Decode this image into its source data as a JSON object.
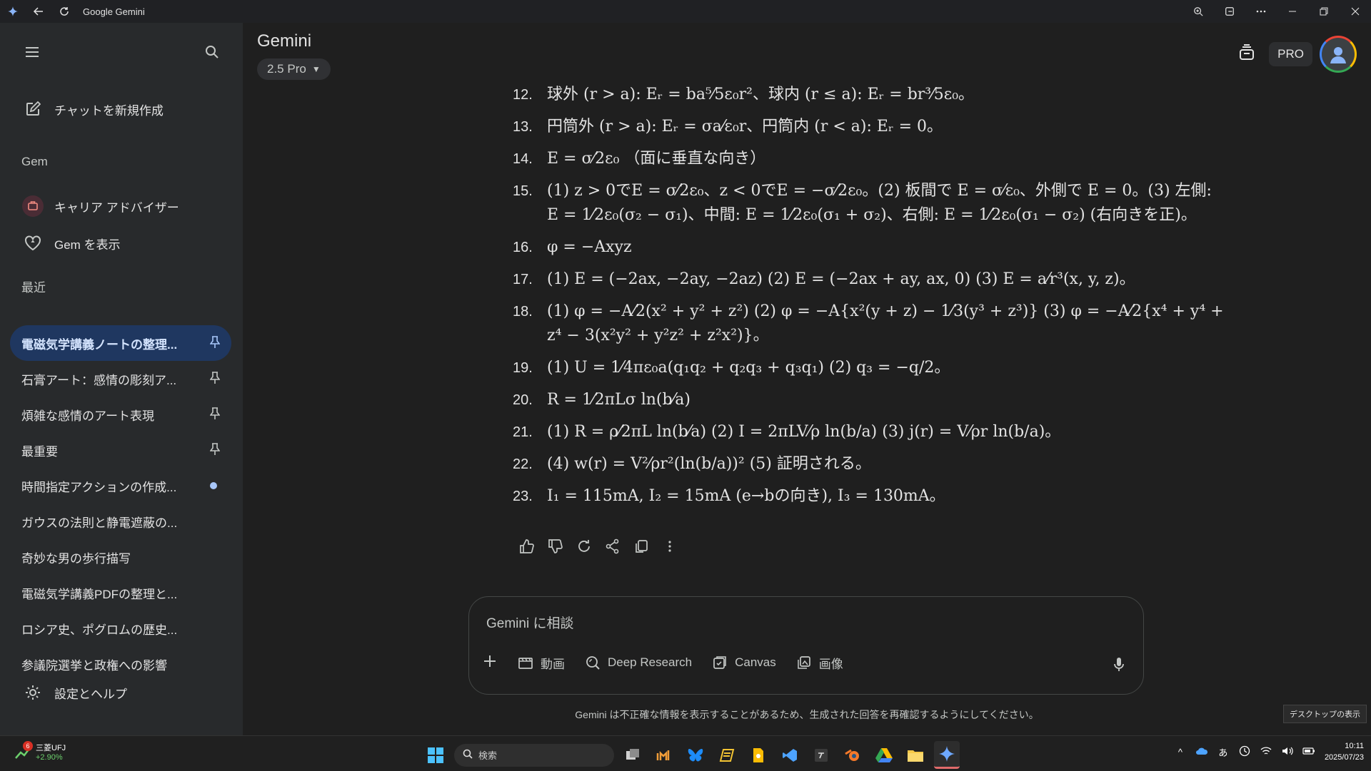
{
  "window": {
    "title": "Google Gemini"
  },
  "sidebar": {
    "new_chat": "チャットを新規作成",
    "gem_section": "Gem",
    "gems": [
      {
        "label": "キャリア アドバイザー"
      },
      {
        "label": "Gem を表示"
      }
    ],
    "recent_section": "最近",
    "recent": [
      {
        "label": "電磁気学講義ノートの整理...",
        "active": true,
        "marker": "pin"
      },
      {
        "label": "石膏アート：感情の彫刻ア...",
        "marker": "pin"
      },
      {
        "label": "煩雑な感情のアート表現",
        "marker": "pin"
      },
      {
        "label": "最重要",
        "marker": "pin"
      },
      {
        "label": "時間指定アクションの作成...",
        "marker": "dot"
      },
      {
        "label": "ガウスの法則と静電遮蔽の..."
      },
      {
        "label": "奇妙な男の歩行描写"
      },
      {
        "label": "電磁気学講義PDFの整理と..."
      },
      {
        "label": "ロシア史、ポグロムの歴史..."
      },
      {
        "label": "参議院選挙と政権への影響"
      }
    ],
    "settings": "設定とヘルプ"
  },
  "header": {
    "app_name": "Gemini",
    "model": "2.5 Pro",
    "badge": "PRO"
  },
  "answers": [
    {
      "num": "12.",
      "text": "球外 (r > a): Eᵣ = ba⁵⁄5ε₀r²、球内 (r ≤ a): Eᵣ = br³⁄5ε₀。"
    },
    {
      "num": "13.",
      "text": "円筒外 (r > a): Eᵣ = σa⁄ε₀r、円筒内 (r < a): Eᵣ = 0。"
    },
    {
      "num": "14.",
      "text": "E = σ⁄2ε₀ （面に垂直な向き）"
    },
    {
      "num": "15.",
      "text": "(1) z > 0でE = σ⁄2ε₀、z < 0でE = −σ⁄2ε₀。(2) 板間で E = σ⁄ε₀、外側で E = 0。(3) 左側: E = 1⁄2ε₀(σ₂ − σ₁)、中間: E = 1⁄2ε₀(σ₁ + σ₂)、右側: E = 1⁄2ε₀(σ₁ − σ₂) (右向きを正)。"
    },
    {
      "num": "16.",
      "text": "φ = −Axyz"
    },
    {
      "num": "17.",
      "text": "(1) E = (−2ax, −2ay, −2az) (2) E = (−2ax + ay, ax, 0) (3) E = a⁄r³(x, y, z)。"
    },
    {
      "num": "18.",
      "text": "(1) φ = −A⁄2(x² + y² + z²) (2) φ = −A{x²(y + z) − 1⁄3(y³ + z³)} (3) φ = −A⁄2{x⁴ + y⁴ + z⁴ − 3(x²y² + y²z² + z²x²)}。"
    },
    {
      "num": "19.",
      "text": "(1) U = 1⁄4πε₀a(q₁q₂ + q₂q₃ + q₃q₁) (2) q₃ = −q/2。"
    },
    {
      "num": "20.",
      "text": "R = 1⁄2πLσ ln(b⁄a)"
    },
    {
      "num": "21.",
      "text": "(1) R = ρ⁄2πL ln(b⁄a) (2) I = 2πLV⁄ρ ln(b/a) (3) j(r) = V⁄ρr ln(b/a)。"
    },
    {
      "num": "22.",
      "text": "(4) w(r) = V²⁄ρr²(ln(b/a))² (5) 証明される。"
    },
    {
      "num": "23.",
      "text": "I₁ = 115mA, I₂ = 15mA (e→bの向き), I₃ = 130mA。"
    }
  ],
  "input": {
    "placeholder": "Gemini に相談",
    "tools": [
      {
        "label": "動画",
        "icon": "video-icon"
      },
      {
        "label": "Deep Research",
        "icon": "deep-research-icon"
      },
      {
        "label": "Canvas",
        "icon": "canvas-icon"
      },
      {
        "label": "画像",
        "icon": "image-icon"
      }
    ]
  },
  "disclaimer": "Gemini は不正確な情報を表示することがあるため、生成された回答を再確認するようにしてください。",
  "desktop_tip": "デスクトップの表示",
  "taskbar": {
    "stock_badge": "6",
    "stock_name": "三菱UFJ",
    "stock_change": "+2.90%",
    "search": "検索",
    "ime": "あ",
    "time": "10:11",
    "date": "2025/07/23"
  }
}
